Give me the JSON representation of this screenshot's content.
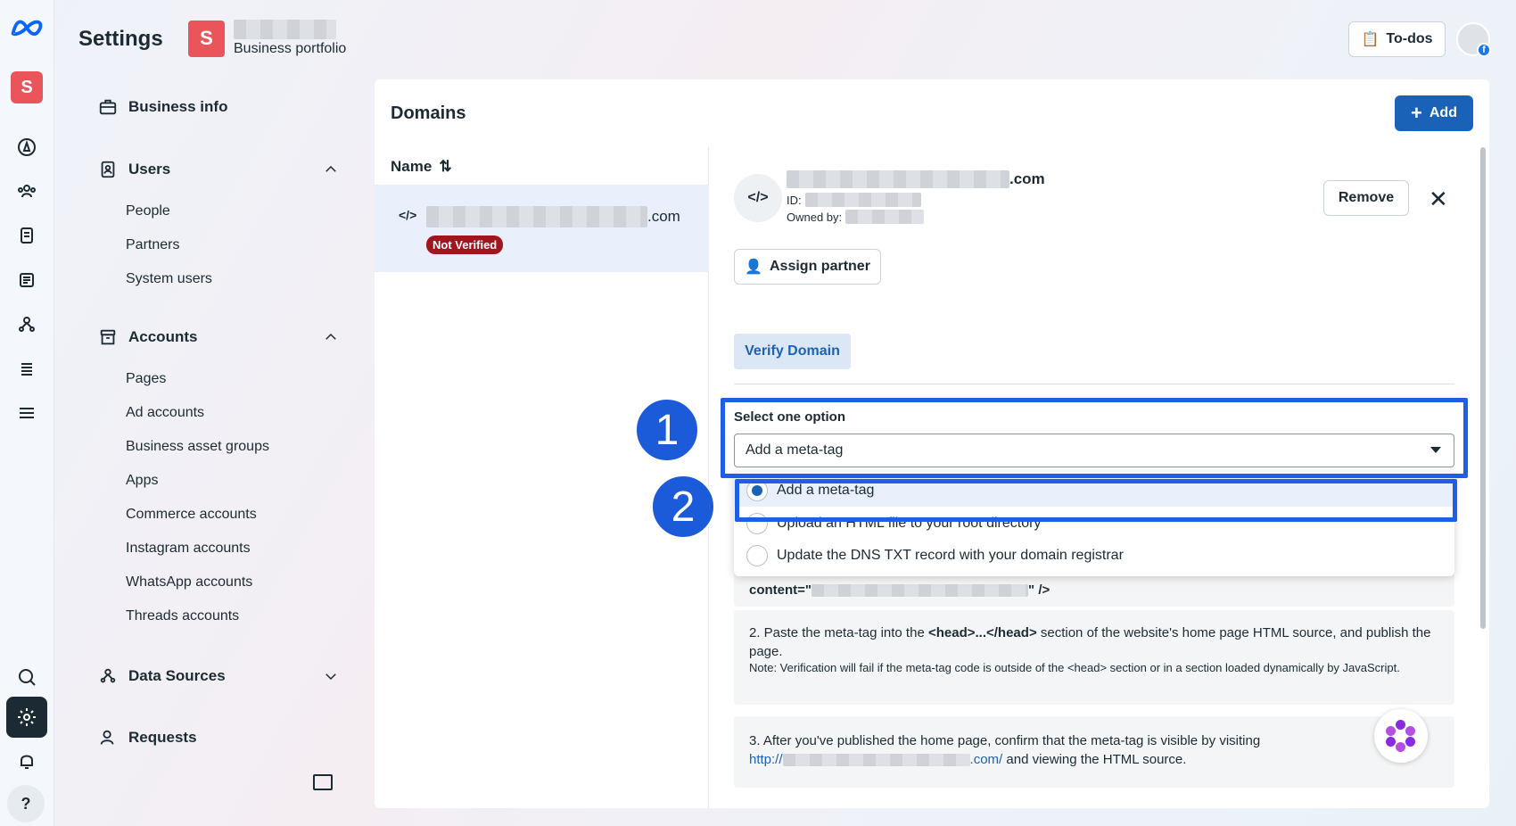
{
  "rail": {
    "avatar_letter": "S",
    "help_label": "?"
  },
  "header": {
    "title": "Settings",
    "portfolio_letter": "S",
    "portfolio_label": "Business portfolio",
    "todos_label": "To-dos"
  },
  "sidebar": {
    "business_info": "Business info",
    "users": {
      "label": "Users",
      "items": [
        "People",
        "Partners",
        "System users"
      ]
    },
    "accounts": {
      "label": "Accounts",
      "items": [
        "Pages",
        "Ad accounts",
        "Business asset groups",
        "Apps",
        "Commerce accounts",
        "Instagram accounts",
        "WhatsApp accounts",
        "Threads accounts"
      ]
    },
    "data_sources": "Data Sources",
    "requests": "Requests"
  },
  "domains": {
    "title": "Domains",
    "add_label": "Add",
    "column_name": "Name",
    "row": {
      "code_icon": "</>",
      "domain_suffix": ".com",
      "status": "Not Verified"
    }
  },
  "detail": {
    "code_icon": "</>",
    "domain_suffix": ".com",
    "id_label": "ID:",
    "owned_label": "Owned by:",
    "remove_label": "Remove",
    "close_icon": "✕",
    "assign_label": "Assign partner",
    "verify_tab": "Verify Domain",
    "select_label": "Select one option",
    "select_value": "Add a meta-tag",
    "options": [
      "Add a meta-tag",
      "Upload an HTML file to your root directory",
      "Update the DNS TXT record with your domain registrar"
    ],
    "content_prefix": "content=\"",
    "content_suffix": "\" />",
    "step2_a": "2. Paste the meta-tag into the ",
    "step2_code": "<head>...</head>",
    "step2_b": " section of the website's home page HTML source, and publish the page.",
    "step2_note": "Note: Verification will fail if the meta-tag code is outside of the <head> section or in a section loaded dynamically by JavaScript.",
    "step3_a": "3. After you've published the home page, confirm that the meta-tag is visible by visiting",
    "step3_link_prefix": "http://",
    "step3_link_suffix": ".com/",
    "step3_b": " and viewing the HTML source."
  },
  "callouts": [
    "1",
    "2"
  ],
  "colors": {
    "accent": "#1a62b8",
    "highlight": "#1f5fe6",
    "badge": "#a1151e",
    "brand_avatar": "#e9555a"
  }
}
